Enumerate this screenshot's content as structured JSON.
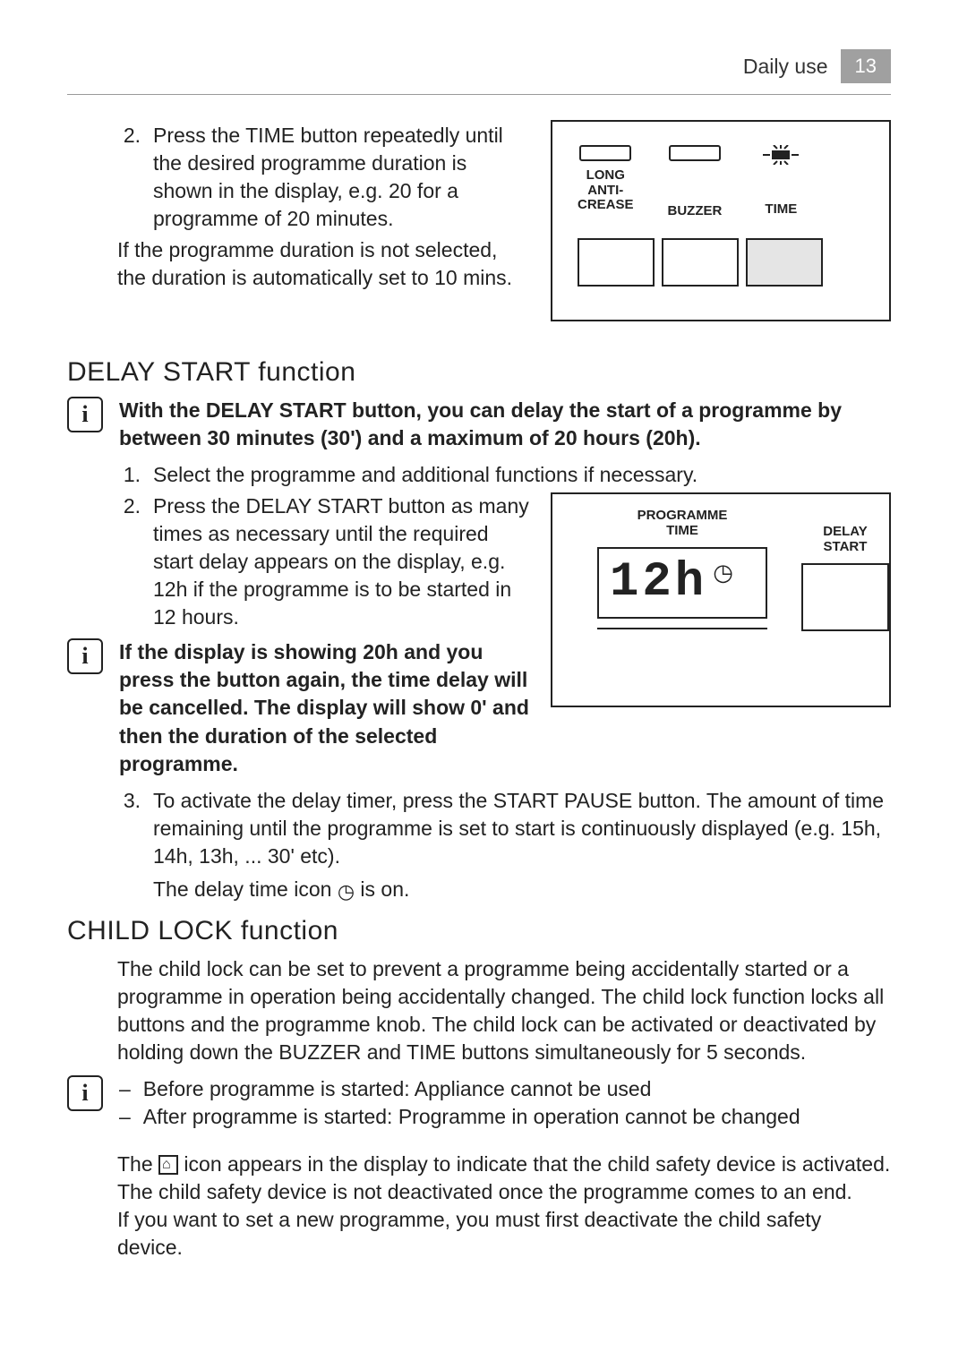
{
  "header": {
    "section_label": "Daily use",
    "page_number": "13"
  },
  "step2": {
    "num": "2.",
    "text": "Press the TIME button repeatedly until the desired programme duration is shown in the display, e.g. 20 for a programme of 20 minutes."
  },
  "step2_after": "If the programme duration is not selected, the duration is automatically set to 10 mins.",
  "panel1": {
    "col1": "LONG ANTI-CREASE",
    "col2": "BUZZER",
    "col3": "TIME"
  },
  "delay_section": {
    "title": "DELAY START function",
    "info1": "With the DELAY START button, you can delay the start of a programme by between 30 minutes (30') and a maximum of 20 hours (20h).",
    "step1_num": "1.",
    "step1": "Select the programme and additional functions if necessary.",
    "step2_num": "2.",
    "step2": "Press the DELAY START button as many times as necessary until the required start delay appears on the display, e.g. 12h if the programme is to be started in 12 hours.",
    "info2": "If the display is showing 20h and you press the button again, the time delay will be cancelled. The display will show 0' and then the duration of the selected programme.",
    "step3_num": "3.",
    "step3": "To activate the delay timer, press the START PAUSE button. The amount of time remaining until the programme is set to start is continuously displayed (e.g. 15h, 14h, 13h, ... 30' etc).",
    "step3_sub": "The delay time icon ",
    "step3_sub_after": " is on."
  },
  "panel2": {
    "label1": "PROGRAMME TIME",
    "label2": "DELAY START",
    "display_value": "12h"
  },
  "childlock": {
    "title": "CHILD LOCK function",
    "para": "The child lock can be set to prevent a programme being accidentally started or a programme in operation being accidentally changed. The child lock function locks all buttons and the programme knob. The child lock can be activated or deactivated by holding down the BUZZER and TIME buttons simultaneously for 5 seconds.",
    "bullet1": "Before programme is started: Appliance cannot be used",
    "bullet2": "After programme is started: Programme in operation cannot be changed",
    "para2a": "The ",
    "para2b": " icon appears in the display to indicate that the child safety device is activated. The child safety device is not deactivated once the programme comes to an end.",
    "para3": "If you want to set a new programme, you must first deactivate the child safety device."
  }
}
